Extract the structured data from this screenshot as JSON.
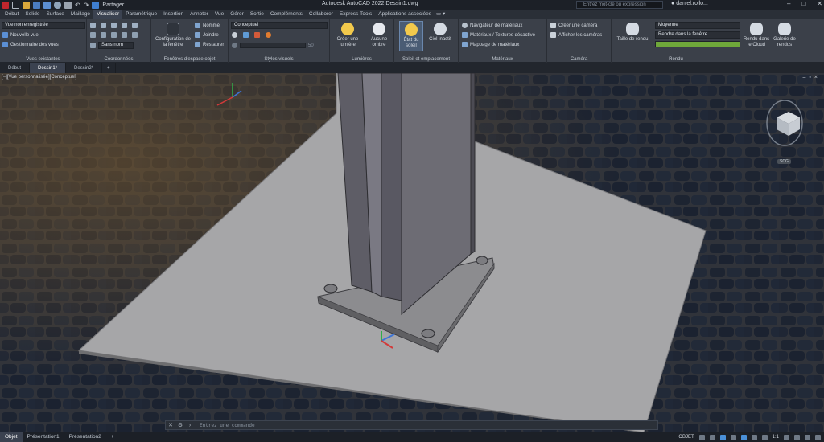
{
  "titlebar": {
    "share_label": "Partager",
    "app_title": "Autodesk AutoCAD 2022   Dessin1.dwg",
    "search_placeholder": "Entrez mot-clé ou expression",
    "user": "daniel.rollo...",
    "window_buttons": [
      "–",
      "□",
      "✕"
    ]
  },
  "ribbon_tabs": [
    "Début",
    "Solide",
    "Surface",
    "Maillage",
    "Visualiser",
    "Paramétrique",
    "Insertion",
    "Annoter",
    "Vue",
    "Gérer",
    "Sortie",
    "Compléments",
    "Collaborer",
    "Express Tools",
    "Applications associées"
  ],
  "active_ribbon_tab": "Visualiser",
  "panels": {
    "vues": {
      "dropdown": "Vue non enregistrée",
      "item1": "Nouvelle vue",
      "item2": "Gestionnaire des vues",
      "label": "Vues existantes"
    },
    "coord": {
      "named": "Sans nom",
      "label": "Coordonnées"
    },
    "fenetres": {
      "config": "Configuration de la fenêtre",
      "nomme": "Nommé",
      "joindre": "Joindre",
      "restaurer": "Restaurer",
      "label": "Fenêtres d'espace objet"
    },
    "styles": {
      "dropdown": "Conceptuel",
      "label": "Styles visuels",
      "opacity": "50"
    },
    "lumieres": {
      "create": "Créer une lumière",
      "none": "Aucune ombre",
      "label": "Lumières"
    },
    "soleil": {
      "state": "État du soleil",
      "sky": "Ciel inactif",
      "label": "Soleil et emplacement"
    },
    "materiaux": {
      "nav": "Navigateur de matériaux",
      "mat_tex": "Matériaux / Textures désactivé",
      "mapping": "Mappage de matériaux",
      "label": "Matériaux"
    },
    "camera": {
      "create": "Créer une caméra",
      "show": "Afficher les caméras",
      "label": "Caméra"
    },
    "rendu": {
      "size": "Taille de rendu",
      "quality": "Moyenne",
      "target": "Rendre dans la fenêtre",
      "cloud": "Rendu dans le Cloud",
      "gallery": "Galerie de rendus",
      "label": "Rendu"
    }
  },
  "doc_tabs": [
    "Début",
    "Dessin1*",
    "Dessin2*"
  ],
  "active_doc_tab": "Dessin1*",
  "viewport": {
    "label": "[−][Vue personnalisée][Conceptuel]",
    "viewcube_label": "SCG"
  },
  "command": {
    "placeholder": "Entrez une commande"
  },
  "layout_tabs": [
    "Objet",
    "Présentation1",
    "Présentation2"
  ],
  "active_layout": "Objet",
  "status_text": "OBJET",
  "scale": "1:1",
  "colors": {
    "ribbon": "#3b4049",
    "accent": "#4a90d9",
    "ground": "#a6a6a8",
    "column": "#6d6c74"
  }
}
